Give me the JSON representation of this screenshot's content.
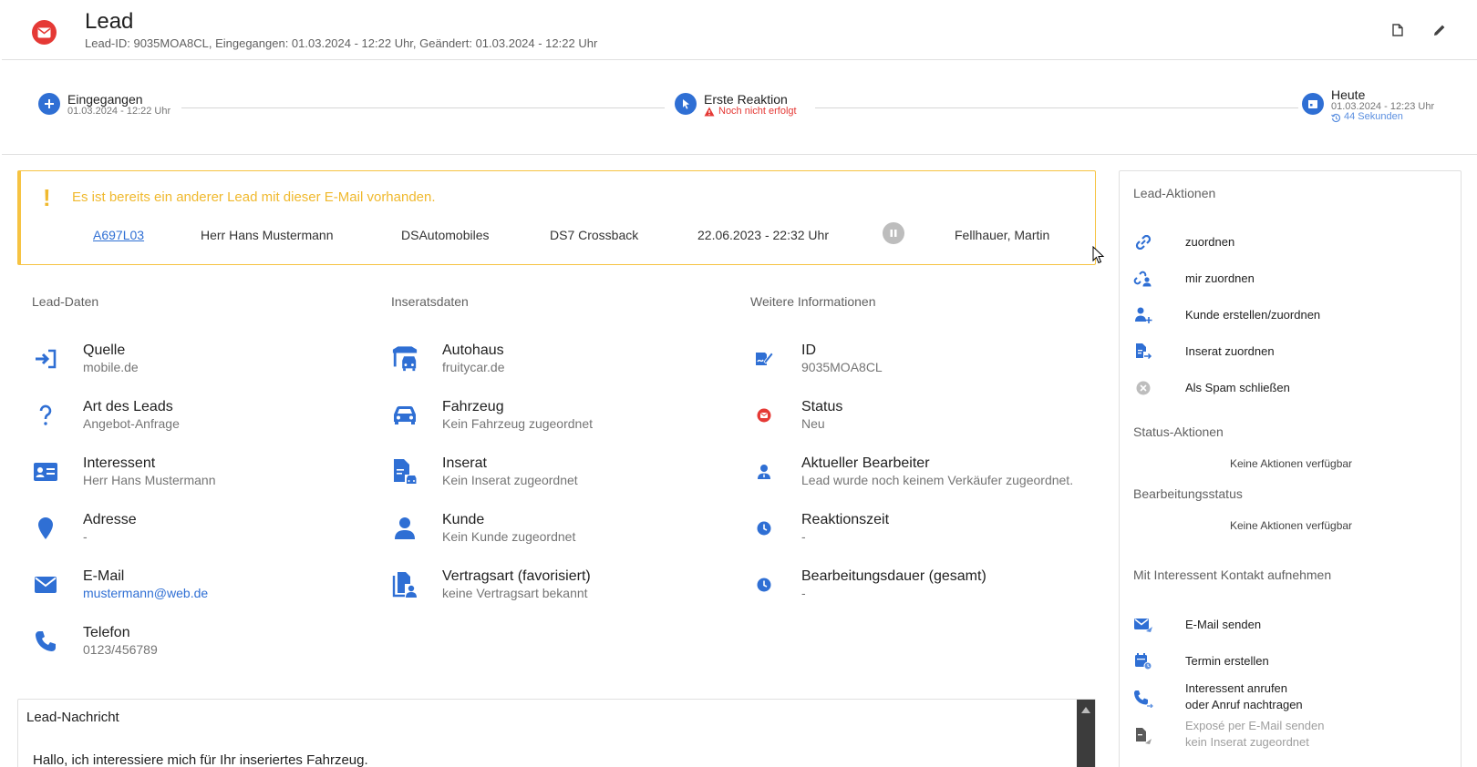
{
  "header": {
    "title": "Lead",
    "subtitle": "Lead-ID: 9035MOA8CL, Eingegangen: 01.03.2024 - 12:22 Uhr, Geändert: 01.03.2024 - 12:22 Uhr"
  },
  "timeline": {
    "steps": [
      {
        "label": "Eingegangen",
        "date": "01.03.2024 - 12:22 Uhr"
      },
      {
        "label": "Erste Reaktion",
        "warning": "Noch nicht erfolgt"
      },
      {
        "label": "Heute",
        "date": "01.03.2024 - 12:23 Uhr",
        "ago": "44 Sekunden"
      }
    ]
  },
  "alert": {
    "mark": "!",
    "title": "Es ist bereits ein anderer Lead mit dieser E-Mail vorhanden.",
    "lead_id": "A697L03",
    "person": "Herr Hans Mustermann",
    "dealer": "DSAutomobiles",
    "vehicle": "DS7 Crossback",
    "date": "22.06.2023 - 22:32 Uhr",
    "agent": "Fellhauer, Martin"
  },
  "sections": {
    "lead_data": {
      "title": "Lead-Daten",
      "fields": [
        {
          "label": "Quelle",
          "value": "mobile.de"
        },
        {
          "label": "Art des Leads",
          "value": "Angebot-Anfrage"
        },
        {
          "label": "Interessent",
          "value": "Herr Hans Mustermann"
        },
        {
          "label": "Adresse",
          "value": "-"
        },
        {
          "label": "E-Mail",
          "value": "mustermann@web.de"
        },
        {
          "label": "Telefon",
          "value": "0123/456789"
        }
      ]
    },
    "ad_data": {
      "title": "Inseratsdaten",
      "fields": [
        {
          "label": "Autohaus",
          "value": "fruitycar.de"
        },
        {
          "label": "Fahrzeug",
          "value": "Kein Fahrzeug zugeordnet"
        },
        {
          "label": "Inserat",
          "value": "Kein Inserat zugeordnet"
        },
        {
          "label": "Kunde",
          "value": "Kein Kunde zugeordnet"
        },
        {
          "label": "Vertragsart (favorisiert)",
          "value": "keine Vertragsart bekannt"
        }
      ]
    },
    "more_info": {
      "title": "Weitere Informationen",
      "fields": [
        {
          "label": "ID",
          "value": "9035MOA8CL"
        },
        {
          "label": "Status",
          "value": "Neu"
        },
        {
          "label": "Aktueller Bearbeiter",
          "value": "Lead wurde noch keinem Verkäufer zugeordnet."
        },
        {
          "label": "Reaktionszeit",
          "value": "-"
        },
        {
          "label": "Bearbeitungsdauer (gesamt)",
          "value": "-"
        }
      ]
    }
  },
  "message": {
    "title": "Lead-Nachricht",
    "body": "Hallo, ich interessiere mich für Ihr inseriertes Fahrzeug."
  },
  "sidebar": {
    "lead_actions_title": "Lead-Aktionen",
    "lead_actions": [
      "zuordnen",
      "mir zuordnen",
      "Kunde erstellen/zuordnen",
      "Inserat zuordnen",
      "Als Spam schließen"
    ],
    "status_title": "Status-Aktionen",
    "status_empty": "Keine Aktionen verfügbar",
    "processing_title": "Bearbeitungsstatus",
    "processing_empty": "Keine Aktionen verfügbar",
    "contact_title": "Mit Interessent Kontakt aufnehmen",
    "contact_actions": [
      {
        "label": "E-Mail senden"
      },
      {
        "label": "Termin erstellen"
      },
      {
        "label": "Interessent anrufen",
        "sub": "oder Anruf nachtragen"
      },
      {
        "label": "Exposé per E-Mail senden",
        "sub": "kein Inserat zugeordnet"
      }
    ]
  },
  "colors": {
    "primary": "#2f6fd4",
    "danger": "#e53935",
    "warning": "#f0b92e"
  }
}
